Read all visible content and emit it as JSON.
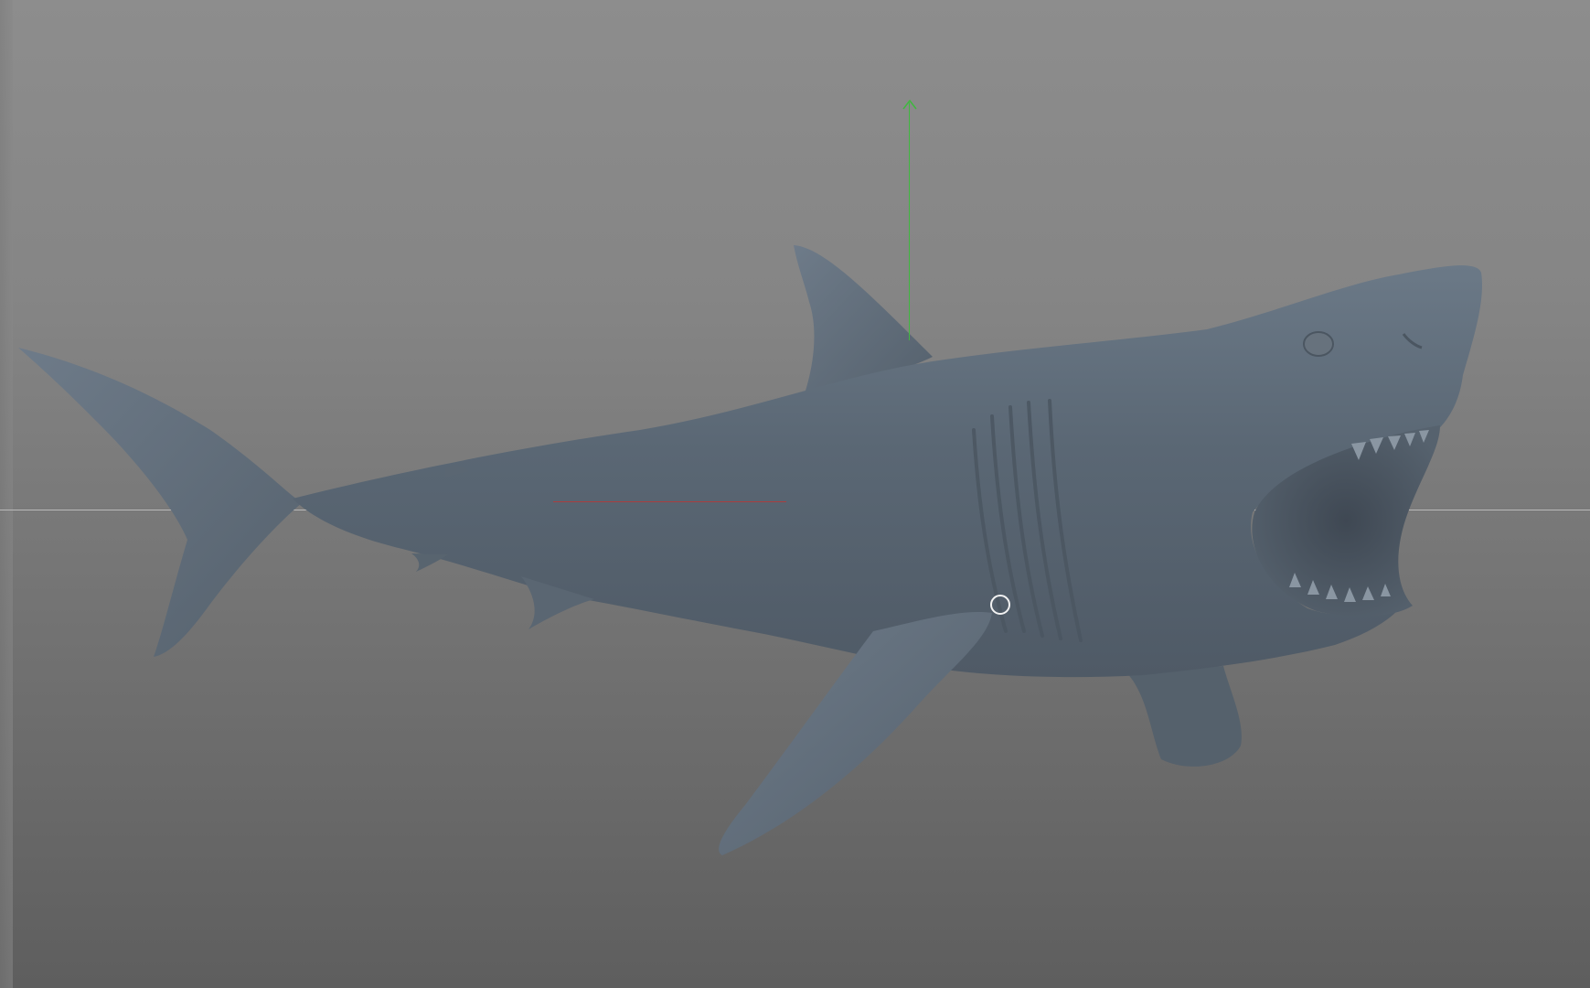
{
  "viewport": {
    "background_top_color": "#8d8d8d",
    "background_bottom_color": "#5e5e5e",
    "object": "shark-3d-model",
    "object_color": "#5f6d7a",
    "axes": {
      "y_axis_color": "#3fb83f",
      "x_axis_color": "#b23a3a",
      "horizon_color": "#b9b9b9"
    },
    "cursor": "circle-cursor"
  }
}
